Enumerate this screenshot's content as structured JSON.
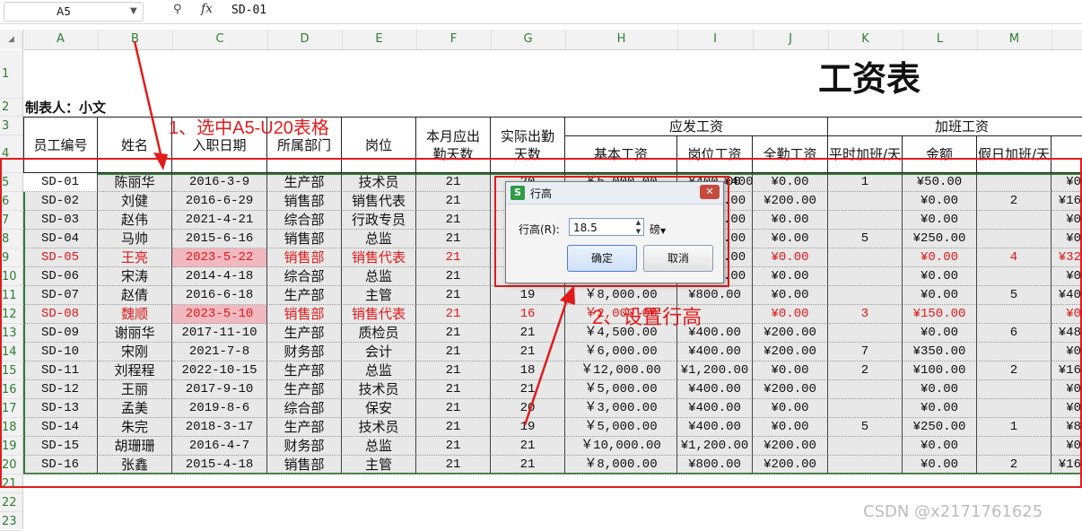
{
  "formula_bar": {
    "cell_ref": "A5",
    "fx_label": "fx",
    "value": "SD-01",
    "zoom_icon": "zoom-icon"
  },
  "columns": [
    "A",
    "B",
    "C",
    "D",
    "E",
    "F",
    "G",
    "H",
    "I",
    "J",
    "K",
    "L",
    "M"
  ],
  "rows": [
    "1",
    "2",
    "3",
    "4",
    "5",
    "6",
    "7",
    "8",
    "9",
    "10",
    "11",
    "12",
    "13",
    "14",
    "15",
    "16",
    "17",
    "18",
    "19",
    "20",
    "21",
    "22",
    "23"
  ],
  "sheet": {
    "title": "工资表",
    "maker": "制表人：小文",
    "headers": {
      "emp_no": "员工编号",
      "name": "姓名",
      "hire_date": "入职日期",
      "dept": "所属部门",
      "post": "岗位",
      "due_days": "本月应出勤天数",
      "actual_days": "实际出勤天数",
      "payable_group": "应发工资",
      "base": "基本工资",
      "post_pay": "岗位工资",
      "attendance": "全勤工资",
      "overtime_group": "加班工资",
      "weekday_ot": "平时加班/天",
      "amount": "金额",
      "holiday_ot": "假日加班/天"
    },
    "data_rows": [
      [
        "SD-01",
        "陈丽华",
        "2016-3-9",
        "生产部",
        "技术员",
        "21",
        "20",
        "￥5,000.00",
        "¥400.00",
        "¥0.00",
        "1",
        "¥50.00",
        "",
        "¥0"
      ],
      [
        "SD-02",
        "刘健",
        "2016-6-29",
        "销售部",
        "销售代表",
        "21",
        "",
        "",
        "",
        "¥200.00",
        "",
        "¥0.00",
        "2",
        "¥16"
      ],
      [
        "SD-03",
        "赵伟",
        "2021-4-21",
        "综合部",
        "行政专员",
        "21",
        "",
        "",
        "",
        "¥0.00",
        "",
        "¥0.00",
        "",
        "¥0"
      ],
      [
        "SD-04",
        "马帅",
        "2015-6-16",
        "销售部",
        "总监",
        "21",
        "",
        "",
        "",
        "¥0.00",
        "5",
        "¥250.00",
        "",
        "¥0"
      ],
      [
        "SD-05",
        "王亮",
        "2023-5-22",
        "销售部",
        "销售代表",
        "21",
        "",
        "",
        "",
        "¥0.00",
        "",
        "¥0.00",
        "4",
        "¥32"
      ],
      [
        "SD-06",
        "宋涛",
        "2014-4-18",
        "综合部",
        "总监",
        "21",
        "",
        "",
        "",
        "¥0.00",
        "",
        "¥0.00",
        "",
        "¥0"
      ],
      [
        "SD-07",
        "赵倩",
        "2016-6-18",
        "生产部",
        "主管",
        "21",
        "19",
        "￥8,000.00",
        "¥800.00",
        "¥0.00",
        "",
        "¥0.00",
        "5",
        "¥40"
      ],
      [
        "SD-08",
        "魏顺",
        "2023-5-10",
        "销售部",
        "销售代表",
        "21",
        "16",
        "￥2,000.00",
        "",
        "¥0.00",
        "3",
        "¥150.00",
        "",
        "¥0"
      ],
      [
        "SD-09",
        "谢丽华",
        "2017-11-10",
        "生产部",
        "质检员",
        "21",
        "21",
        "￥4,500.00",
        "¥400.00",
        "¥200.00",
        "",
        "¥0.00",
        "6",
        "¥48"
      ],
      [
        "SD-10",
        "宋刚",
        "2021-7-8",
        "财务部",
        "会计",
        "21",
        "21",
        "￥6,000.00",
        "¥400.00",
        "¥200.00",
        "7",
        "¥350.00",
        "",
        "¥0"
      ],
      [
        "SD-11",
        "刘程程",
        "2022-10-15",
        "生产部",
        "总监",
        "21",
        "18",
        "￥12,000.00",
        "¥1,200.00",
        "¥0.00",
        "2",
        "¥100.00",
        "2",
        "¥16"
      ],
      [
        "SD-12",
        "王丽",
        "2017-9-10",
        "生产部",
        "技术员",
        "21",
        "21",
        "￥5,000.00",
        "¥400.00",
        "¥200.00",
        "",
        "¥0.00",
        "",
        "¥0"
      ],
      [
        "SD-13",
        "孟美",
        "2019-8-6",
        "综合部",
        "保安",
        "21",
        "20",
        "￥3,000.00",
        "¥400.00",
        "¥0.00",
        "",
        "¥0.00",
        "",
        "¥0"
      ],
      [
        "SD-14",
        "朱完",
        "2018-3-17",
        "生产部",
        "技术员",
        "21",
        "19",
        "￥5,000.00",
        "¥400.00",
        "¥0.00",
        "5",
        "¥250.00",
        "1",
        "¥8"
      ],
      [
        "SD-15",
        "胡珊珊",
        "2016-4-7",
        "财务部",
        "总监",
        "21",
        "21",
        "￥10,000.00",
        "¥1,200.00",
        "¥200.00",
        "",
        "¥0.00",
        "",
        "¥0"
      ],
      [
        "SD-16",
        "张鑫",
        "2015-4-18",
        "销售部",
        "主管",
        "21",
        "21",
        "￥8,000.00",
        "¥800.00",
        "¥200.00",
        "",
        "¥0.00",
        "2",
        "¥16"
      ]
    ],
    "i_partial_row1": "¥400",
    "i_partial_row2": ".00",
    "i_partial_row3": ".00",
    "i_partial_row4": ".00",
    "i_partial_row5": ".00",
    "i_partial_row6": ".00"
  },
  "dialog": {
    "title": "行高",
    "icon_letter": "S",
    "label": "行高(R):",
    "value": "18.5",
    "unit": "磅",
    "ok": "确定",
    "cancel": "取消"
  },
  "annotations": {
    "step1": "1、选中A5-U20表格",
    "step2": "2、设置行高"
  },
  "watermark": "CSDN @x2171761625",
  "colors": {
    "annotation": "#e11b1b",
    "selection_border": "#2e7d32",
    "header_text": "#2e7d32"
  }
}
